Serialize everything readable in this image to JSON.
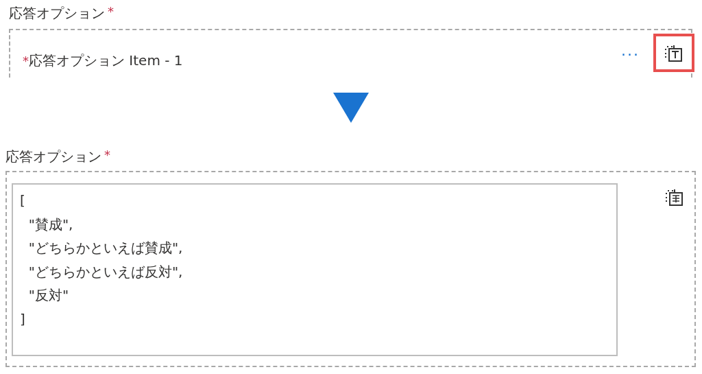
{
  "before": {
    "label": "応答オプション",
    "required_mark": "*",
    "item": {
      "required_mark": "*",
      "title": "応答オプション Item - 1",
      "more": "···",
      "switch_mode_highlighted": true
    }
  },
  "after": {
    "label": "応答オプション",
    "required_mark": "*",
    "value_lines": [
      "[",
      "  \"賛成\",",
      "  \"どちらかといえば賛成\",",
      "  \"どちらかといえば反対\",",
      "  \"反対\"",
      "]"
    ]
  }
}
